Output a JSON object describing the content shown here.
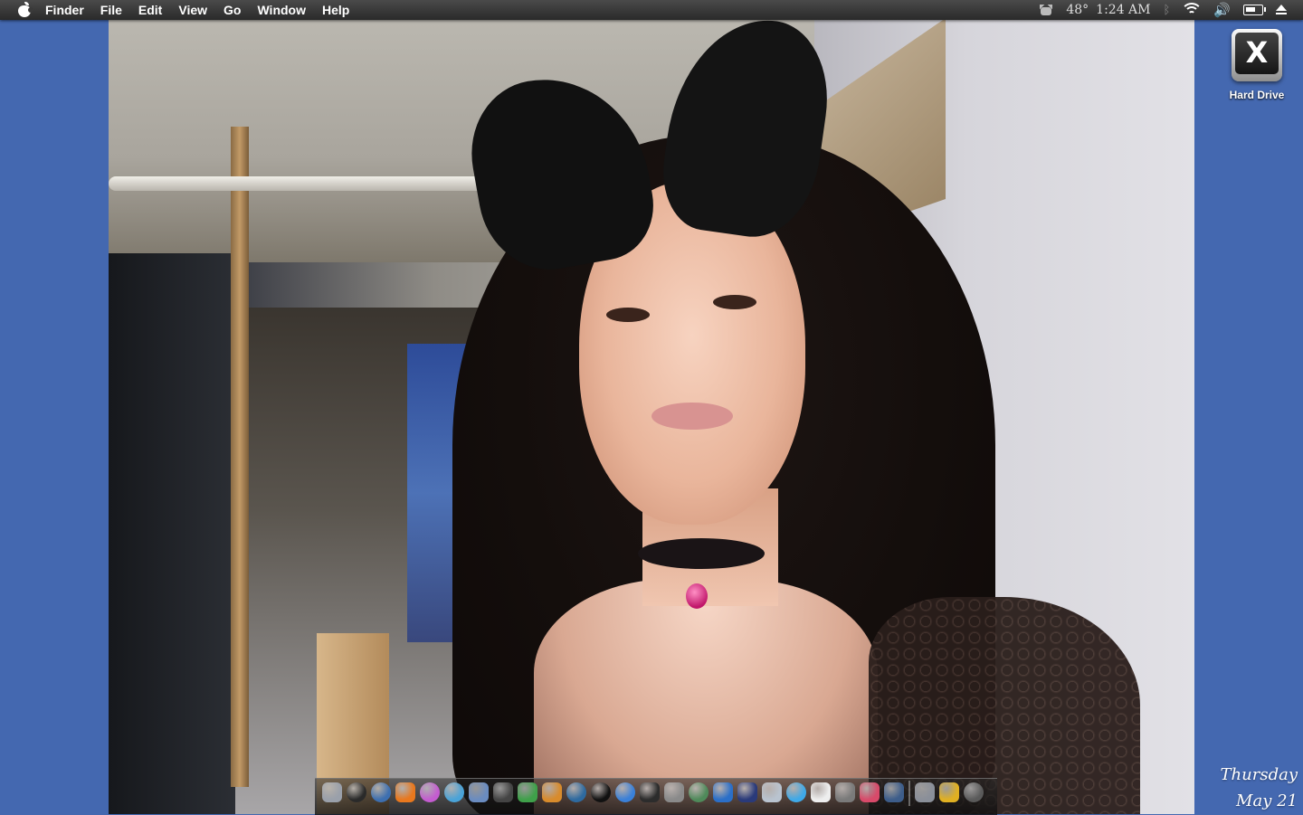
{
  "menubar": {
    "app": "Finder",
    "items": [
      "File",
      "Edit",
      "View",
      "Go",
      "Window",
      "Help"
    ],
    "temperature": "48°",
    "time": "1:24 AM"
  },
  "desktop": {
    "drive_label": "Hard Drive",
    "drive_glyph": "X"
  },
  "clock": {
    "day": "Thursday",
    "date": "May 21"
  },
  "dock": {
    "icons": [
      {
        "name": "finder-icon",
        "color": "#9aa0aa"
      },
      {
        "name": "dashboard-icon",
        "color": "#2a2a2a"
      },
      {
        "name": "safari-compass-icon",
        "color": "#3d6fb0"
      },
      {
        "name": "firefox-icon",
        "color": "#e8781e"
      },
      {
        "name": "itunes-icon",
        "color": "#c45cd0"
      },
      {
        "name": "globe-icon",
        "color": "#4aa3d8"
      },
      {
        "name": "mail-icon",
        "color": "#6a8cc0"
      },
      {
        "name": "pen-tool-icon",
        "color": "#444"
      },
      {
        "name": "leaf-app-icon",
        "color": "#3fa04a"
      },
      {
        "name": "burger-app-icon",
        "color": "#d88b2c"
      },
      {
        "name": "cd-icon",
        "color": "#2e6aa0"
      },
      {
        "name": "eye-icon",
        "color": "#111"
      },
      {
        "name": "safari-icon",
        "color": "#3a80d8"
      },
      {
        "name": "terminal-icon",
        "color": "#2c2c2c"
      },
      {
        "name": "car-app-icon",
        "color": "#8a8a8a"
      },
      {
        "name": "network-globe-icon",
        "color": "#4f8a5a"
      },
      {
        "name": "chat-bubble-icon",
        "color": "#2b6fc8"
      },
      {
        "name": "xcode-icon",
        "color": "#2a3a7a"
      },
      {
        "name": "bottle-icon",
        "color": "#b9c3cf"
      },
      {
        "name": "messages-icon",
        "color": "#3fa9e8"
      },
      {
        "name": "calendar-icon",
        "color": "#eeeeee"
      },
      {
        "name": "preferences-icon",
        "color": "#7a7a7a"
      },
      {
        "name": "pin-icon",
        "color": "#d84a6a"
      },
      {
        "name": "monitor-icon",
        "color": "#3d5d8a"
      },
      {
        "name": "separator",
        "color": ""
      },
      {
        "name": "documents-folder-icon",
        "color": "#8a8f99"
      },
      {
        "name": "downloads-folder-icon",
        "color": "#e0b022"
      },
      {
        "name": "trash-icon",
        "color": "#5a5a5a"
      }
    ]
  }
}
